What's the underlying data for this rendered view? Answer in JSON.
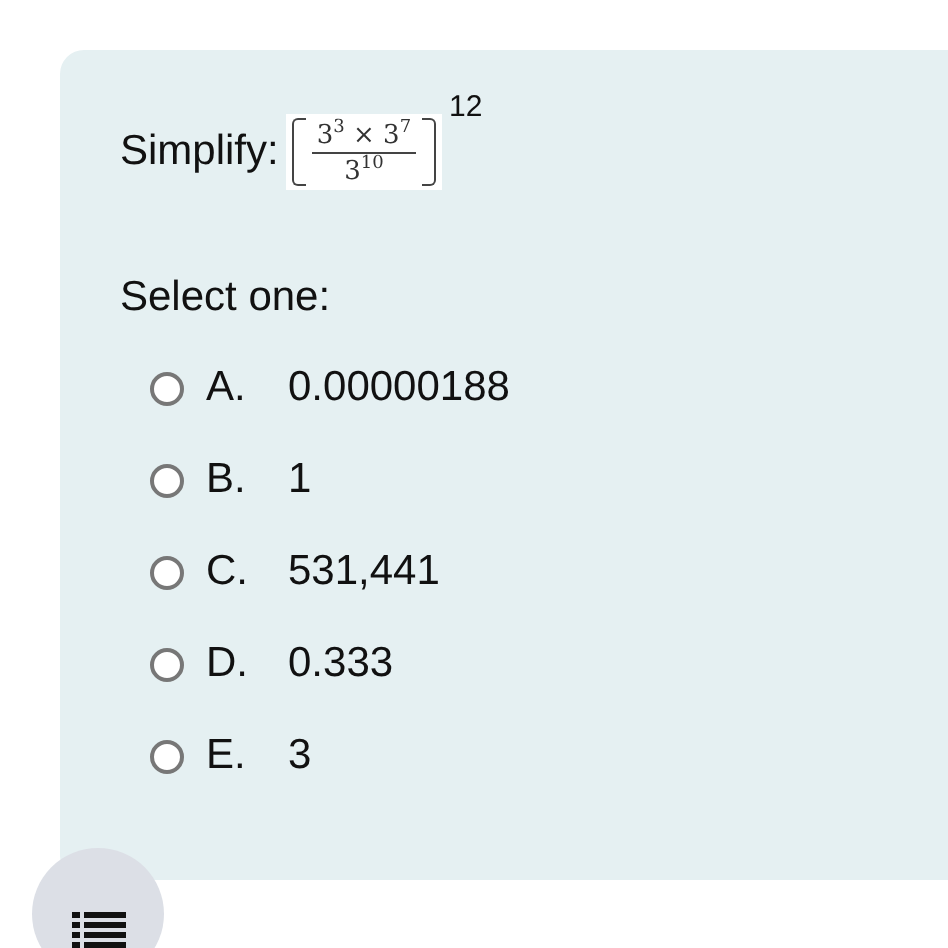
{
  "question": {
    "label": "Simplify:",
    "numerator": "3$^{3}$ × 3$^{7}$",
    "denominator": "3$^{10}$",
    "exponent": "12"
  },
  "prompt": "Select one:",
  "options": [
    {
      "letter": "A.",
      "text": "0.00000188",
      "selected": false
    },
    {
      "letter": "B.",
      "text": "1",
      "selected": false
    },
    {
      "letter": "C.",
      "text": "531,441",
      "selected": false
    },
    {
      "letter": "D.",
      "text": "0.333",
      "selected": false
    },
    {
      "letter": "E.",
      "text": "3",
      "selected": false
    }
  ]
}
